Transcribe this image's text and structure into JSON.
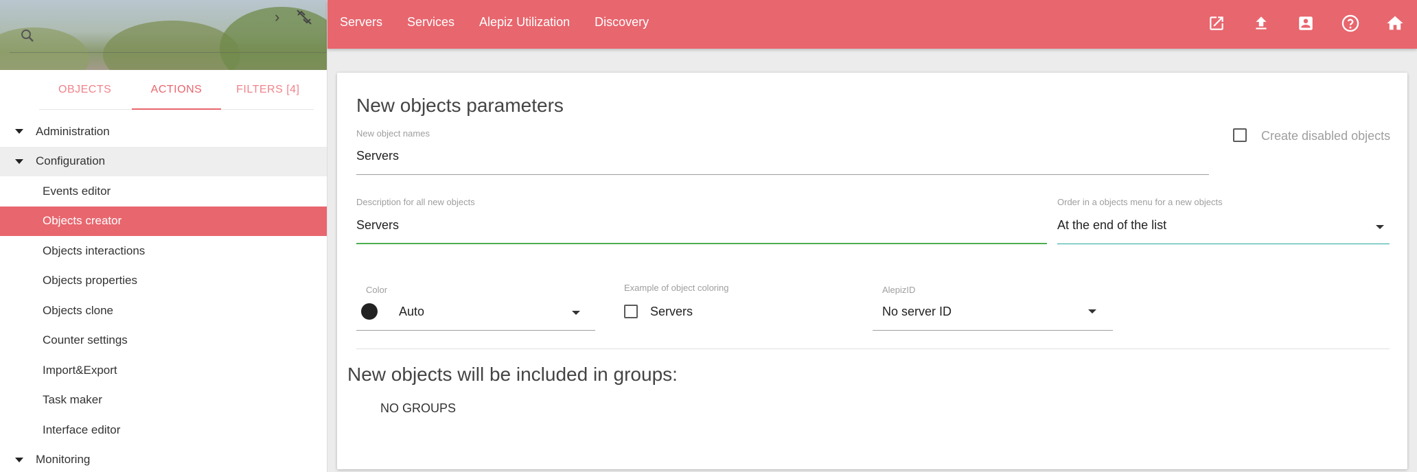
{
  "sidebar": {
    "search": {
      "placeholder": ""
    },
    "tabs": [
      {
        "label": "OBJECTS",
        "active": false
      },
      {
        "label": "ACTIONS",
        "active": true
      },
      {
        "label": "FILTERS [4]",
        "active": false
      }
    ],
    "tree": [
      {
        "label": "Administration",
        "type": "parent"
      },
      {
        "label": "Configuration",
        "type": "parent",
        "highlighted": true
      },
      {
        "label": "Events editor",
        "type": "child"
      },
      {
        "label": "Objects creator",
        "type": "child",
        "selected": true
      },
      {
        "label": "Objects interactions",
        "type": "child"
      },
      {
        "label": "Objects properties",
        "type": "child"
      },
      {
        "label": "Objects clone",
        "type": "child"
      },
      {
        "label": "Counter settings",
        "type": "child"
      },
      {
        "label": "Import&Export",
        "type": "child"
      },
      {
        "label": "Task maker",
        "type": "child"
      },
      {
        "label": "Interface editor",
        "type": "child"
      },
      {
        "label": "Monitoring",
        "type": "parent"
      }
    ]
  },
  "topbar": {
    "nav": [
      "Servers",
      "Services",
      "Alepiz Utilization",
      "Discovery"
    ],
    "icons": [
      "open-in-new-icon",
      "upload-icon",
      "contact-card-icon",
      "help-icon",
      "home-icon"
    ]
  },
  "form": {
    "title": "New objects parameters",
    "names": {
      "label": "New object names",
      "value": "Servers"
    },
    "create_disabled": {
      "label": "Create disabled objects",
      "checked": false
    },
    "description": {
      "label": "Description for all new objects",
      "value": "Servers"
    },
    "order": {
      "label": "Order in a objects menu for a new objects",
      "value": "At the end of the list"
    },
    "color": {
      "label": "Color",
      "value": "Auto",
      "swatch": "#222222"
    },
    "example": {
      "label": "Example of object coloring",
      "value": "Servers",
      "checked": false
    },
    "alepiz_id": {
      "label": "AlepizID",
      "value": "No server ID"
    },
    "groups_title": "New objects will be included in groups:",
    "groups_value": "NO GROUPS"
  },
  "colors": {
    "accent": "#e8666e",
    "valid": "#4caf50",
    "focus": "#26a69a"
  }
}
